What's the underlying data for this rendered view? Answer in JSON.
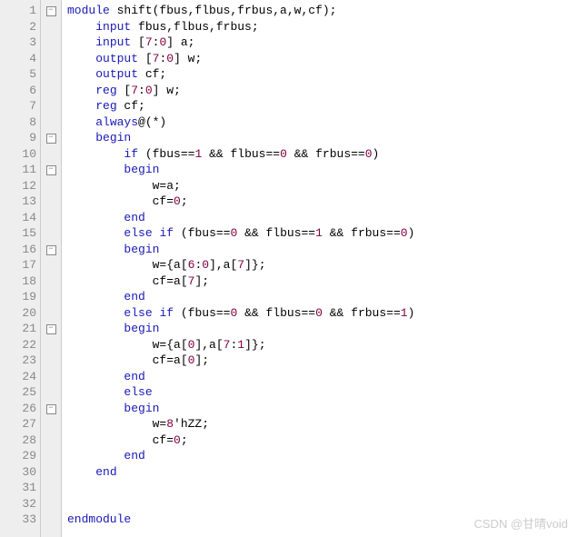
{
  "lines": [
    {
      "n": 1,
      "fold": "-",
      "tokens": [
        [
          "kw",
          "module"
        ],
        [
          "txt",
          " shift(fbus,flbus,frbus,a,w,cf);"
        ]
      ]
    },
    {
      "n": 2,
      "fold": "",
      "tokens": [
        [
          "txt",
          "    "
        ],
        [
          "kw",
          "input"
        ],
        [
          "txt",
          " fbus,flbus,frbus;"
        ]
      ]
    },
    {
      "n": 3,
      "fold": "",
      "tokens": [
        [
          "txt",
          "    "
        ],
        [
          "kw",
          "input"
        ],
        [
          "txt",
          " ["
        ],
        [
          "op",
          "7"
        ],
        [
          "txt",
          ":"
        ],
        [
          "op",
          "0"
        ],
        [
          "txt",
          "] a;"
        ]
      ]
    },
    {
      "n": 4,
      "fold": "",
      "tokens": [
        [
          "txt",
          "    "
        ],
        [
          "kw",
          "output"
        ],
        [
          "txt",
          " ["
        ],
        [
          "op",
          "7"
        ],
        [
          "txt",
          ":"
        ],
        [
          "op",
          "0"
        ],
        [
          "txt",
          "] w;"
        ]
      ]
    },
    {
      "n": 5,
      "fold": "",
      "tokens": [
        [
          "txt",
          "    "
        ],
        [
          "kw",
          "output"
        ],
        [
          "txt",
          " cf;"
        ]
      ]
    },
    {
      "n": 6,
      "fold": "",
      "tokens": [
        [
          "txt",
          "    "
        ],
        [
          "kw",
          "reg"
        ],
        [
          "txt",
          " ["
        ],
        [
          "op",
          "7"
        ],
        [
          "txt",
          ":"
        ],
        [
          "op",
          "0"
        ],
        [
          "txt",
          "] w;"
        ]
      ]
    },
    {
      "n": 7,
      "fold": "",
      "tokens": [
        [
          "txt",
          "    "
        ],
        [
          "kw",
          "reg"
        ],
        [
          "txt",
          " cf;"
        ]
      ]
    },
    {
      "n": 8,
      "fold": "",
      "tokens": [
        [
          "txt",
          "    "
        ],
        [
          "kw",
          "always"
        ],
        [
          "txt",
          "@(*)"
        ]
      ]
    },
    {
      "n": 9,
      "fold": "-",
      "tokens": [
        [
          "txt",
          "    "
        ],
        [
          "kw",
          "begin"
        ]
      ]
    },
    {
      "n": 10,
      "fold": "",
      "tokens": [
        [
          "txt",
          "        "
        ],
        [
          "kw",
          "if"
        ],
        [
          "txt",
          " (fbus=="
        ],
        [
          "op",
          "1"
        ],
        [
          "txt",
          " && flbus=="
        ],
        [
          "op",
          "0"
        ],
        [
          "txt",
          " && frbus=="
        ],
        [
          "op",
          "0"
        ],
        [
          "txt",
          ")"
        ]
      ]
    },
    {
      "n": 11,
      "fold": "-",
      "tokens": [
        [
          "txt",
          "        "
        ],
        [
          "kw",
          "begin"
        ]
      ]
    },
    {
      "n": 12,
      "fold": "",
      "tokens": [
        [
          "txt",
          "            w=a;"
        ]
      ]
    },
    {
      "n": 13,
      "fold": "",
      "tokens": [
        [
          "txt",
          "            cf="
        ],
        [
          "op",
          "0"
        ],
        [
          "txt",
          ";"
        ]
      ]
    },
    {
      "n": 14,
      "fold": "",
      "tokens": [
        [
          "txt",
          "        "
        ],
        [
          "kw",
          "end"
        ]
      ]
    },
    {
      "n": 15,
      "fold": "",
      "tokens": [
        [
          "txt",
          "        "
        ],
        [
          "kw",
          "else"
        ],
        [
          "txt",
          " "
        ],
        [
          "kw",
          "if"
        ],
        [
          "txt",
          " (fbus=="
        ],
        [
          "op",
          "0"
        ],
        [
          "txt",
          " && flbus=="
        ],
        [
          "op",
          "1"
        ],
        [
          "txt",
          " && frbus=="
        ],
        [
          "op",
          "0"
        ],
        [
          "txt",
          ")"
        ]
      ]
    },
    {
      "n": 16,
      "fold": "-",
      "tokens": [
        [
          "txt",
          "        "
        ],
        [
          "kw",
          "begin"
        ]
      ]
    },
    {
      "n": 17,
      "fold": "",
      "tokens": [
        [
          "txt",
          "            w={a["
        ],
        [
          "op",
          "6"
        ],
        [
          "txt",
          ":"
        ],
        [
          "op",
          "0"
        ],
        [
          "txt",
          "],a["
        ],
        [
          "op",
          "7"
        ],
        [
          "txt",
          "]};"
        ]
      ]
    },
    {
      "n": 18,
      "fold": "",
      "tokens": [
        [
          "txt",
          "            cf=a["
        ],
        [
          "op",
          "7"
        ],
        [
          "txt",
          "];"
        ]
      ]
    },
    {
      "n": 19,
      "fold": "",
      "tokens": [
        [
          "txt",
          "        "
        ],
        [
          "kw",
          "end"
        ]
      ]
    },
    {
      "n": 20,
      "fold": "",
      "tokens": [
        [
          "txt",
          "        "
        ],
        [
          "kw",
          "else"
        ],
        [
          "txt",
          " "
        ],
        [
          "kw",
          "if"
        ],
        [
          "txt",
          " (fbus=="
        ],
        [
          "op",
          "0"
        ],
        [
          "txt",
          " && flbus=="
        ],
        [
          "op",
          "0"
        ],
        [
          "txt",
          " && frbus=="
        ],
        [
          "op",
          "1"
        ],
        [
          "txt",
          ")"
        ]
      ]
    },
    {
      "n": 21,
      "fold": "-",
      "tokens": [
        [
          "txt",
          "        "
        ],
        [
          "kw",
          "begin"
        ]
      ]
    },
    {
      "n": 22,
      "fold": "",
      "tokens": [
        [
          "txt",
          "            w={a["
        ],
        [
          "op",
          "0"
        ],
        [
          "txt",
          "],a["
        ],
        [
          "op",
          "7"
        ],
        [
          "txt",
          ":"
        ],
        [
          "op",
          "1"
        ],
        [
          "txt",
          "]};"
        ]
      ]
    },
    {
      "n": 23,
      "fold": "",
      "tokens": [
        [
          "txt",
          "            cf=a["
        ],
        [
          "op",
          "0"
        ],
        [
          "txt",
          "];"
        ]
      ]
    },
    {
      "n": 24,
      "fold": "",
      "tokens": [
        [
          "txt",
          "        "
        ],
        [
          "kw",
          "end"
        ]
      ]
    },
    {
      "n": 25,
      "fold": "",
      "tokens": [
        [
          "txt",
          "        "
        ],
        [
          "kw",
          "else"
        ]
      ]
    },
    {
      "n": 26,
      "fold": "-",
      "tokens": [
        [
          "txt",
          "        "
        ],
        [
          "kw",
          "begin"
        ]
      ]
    },
    {
      "n": 27,
      "fold": "",
      "tokens": [
        [
          "txt",
          "            w="
        ],
        [
          "op",
          "8"
        ],
        [
          "txt",
          "'hZZ;"
        ]
      ]
    },
    {
      "n": 28,
      "fold": "",
      "tokens": [
        [
          "txt",
          "            cf="
        ],
        [
          "op",
          "0"
        ],
        [
          "txt",
          ";"
        ]
      ]
    },
    {
      "n": 29,
      "fold": "",
      "tokens": [
        [
          "txt",
          "        "
        ],
        [
          "kw",
          "end"
        ]
      ]
    },
    {
      "n": 30,
      "fold": "",
      "tokens": [
        [
          "txt",
          "    "
        ],
        [
          "kw",
          "end"
        ]
      ]
    },
    {
      "n": 31,
      "fold": "",
      "tokens": [
        [
          "txt",
          ""
        ]
      ]
    },
    {
      "n": 32,
      "fold": "",
      "tokens": [
        [
          "txt",
          ""
        ]
      ]
    },
    {
      "n": 33,
      "fold": "",
      "tokens": [
        [
          "kw",
          "endmodule"
        ]
      ]
    }
  ],
  "watermark": "CSDN @甘晴void"
}
